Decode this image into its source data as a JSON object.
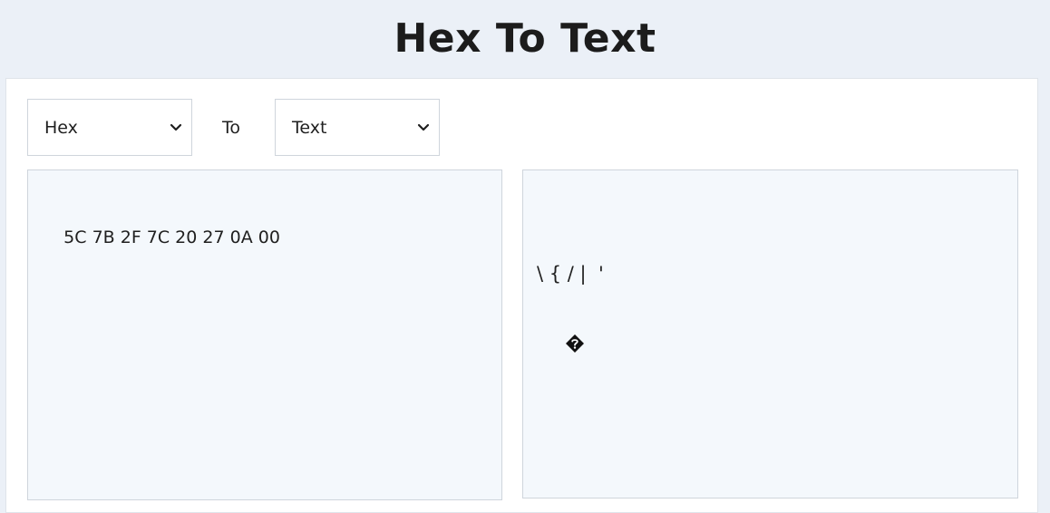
{
  "header": {
    "title": "Hex To Text"
  },
  "converter": {
    "from_select": {
      "selected": "Hex"
    },
    "to_label": "To",
    "to_select": {
      "selected": "Text"
    },
    "input": {
      "value": "5C 7B 2F 7C 20 27 0A 00"
    },
    "output": {
      "line1": "\\ { / |  '",
      "line2_icon": "replacement-character-icon"
    }
  },
  "colors": {
    "page_background": "#ebf0f7",
    "panel_background": "#f4f8fc",
    "border": "#cfd5dc",
    "text": "#1f1f1f"
  }
}
